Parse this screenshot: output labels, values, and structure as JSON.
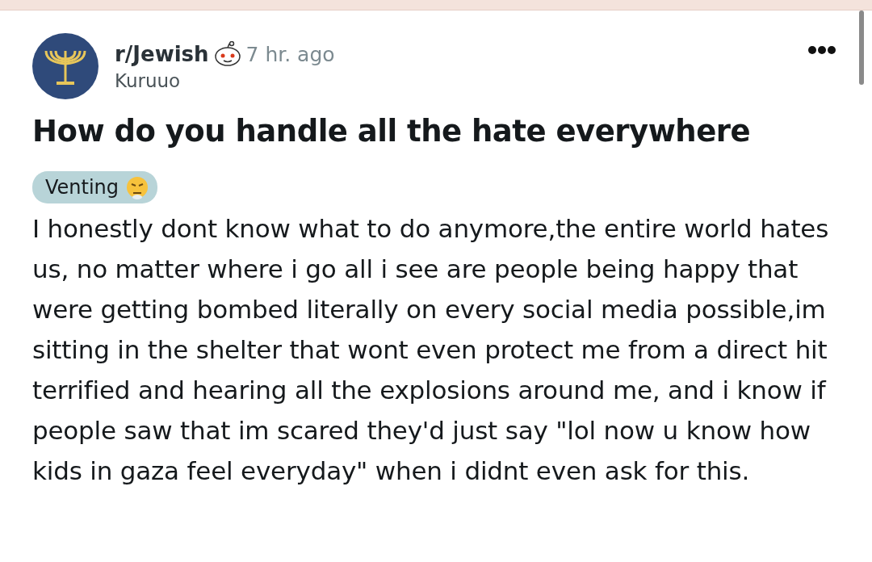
{
  "post": {
    "subreddit": "r/Jewish",
    "time": "7 hr. ago",
    "author": "Kuruuo",
    "title": "How do you handle all the hate everywhere",
    "flair": "Venting",
    "body": "I honestly dont know what to do anymore,the entire world hates us, no matter where i go all i see are people being happy that were getting bombed literally on every social media possible,im sitting in the shelter that wont even protect me from a direct hit terrified and hearing all the explosions around me, and i know if people saw that im scared they'd just say \"lol now u know how kids in gaza feel everyday\" when i didnt even ask for this."
  }
}
